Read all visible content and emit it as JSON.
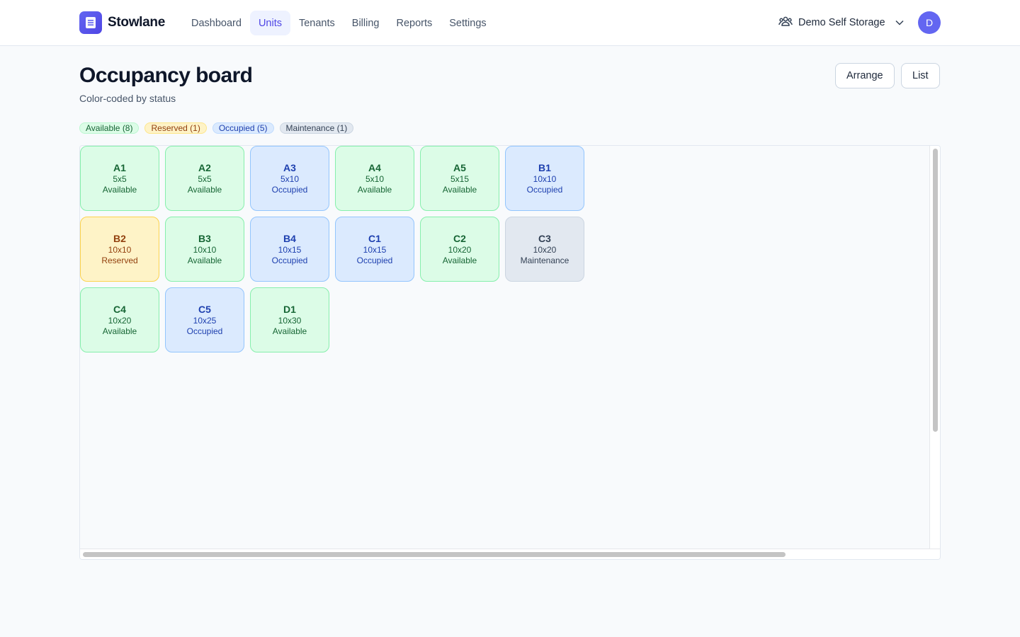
{
  "app": {
    "name": "Stowlane",
    "logo_icon": "document-list-icon"
  },
  "nav": {
    "items": [
      {
        "label": "Dashboard",
        "active": false
      },
      {
        "label": "Units",
        "active": true
      },
      {
        "label": "Tenants",
        "active": false
      },
      {
        "label": "Billing",
        "active": false
      },
      {
        "label": "Reports",
        "active": false
      },
      {
        "label": "Settings",
        "active": false
      }
    ]
  },
  "org": {
    "name": "Demo Self Storage",
    "icon": "users-icon",
    "chevron": "chevron-down-icon"
  },
  "user": {
    "initial": "D",
    "avatar_color": "#6366f1"
  },
  "page": {
    "title": "Occupancy board",
    "subtitle": "Color-coded by status",
    "actions": {
      "arrange": "Arrange",
      "list": "List"
    }
  },
  "legend": [
    {
      "key": "available",
      "label": "Available (8)"
    },
    {
      "key": "reserved",
      "label": "Reserved (1)"
    },
    {
      "key": "occupied",
      "label": "Occupied (5)"
    },
    {
      "key": "maintenance",
      "label": "Maintenance (1)"
    }
  ],
  "status_colors": {
    "available": "#dcfce7",
    "reserved": "#fef3c7",
    "occupied": "#dbeafe",
    "maintenance": "#e2e8f0"
  },
  "units": [
    {
      "name": "A1",
      "size": "5x5",
      "status": "Available",
      "key": "available"
    },
    {
      "name": "A2",
      "size": "5x5",
      "status": "Available",
      "key": "available"
    },
    {
      "name": "A3",
      "size": "5x10",
      "status": "Occupied",
      "key": "occupied"
    },
    {
      "name": "A4",
      "size": "5x10",
      "status": "Available",
      "key": "available"
    },
    {
      "name": "A5",
      "size": "5x15",
      "status": "Available",
      "key": "available"
    },
    {
      "name": "B1",
      "size": "10x10",
      "status": "Occupied",
      "key": "occupied"
    },
    {
      "name": "B2",
      "size": "10x10",
      "status": "Reserved",
      "key": "reserved"
    },
    {
      "name": "B3",
      "size": "10x10",
      "status": "Available",
      "key": "available"
    },
    {
      "name": "B4",
      "size": "10x15",
      "status": "Occupied",
      "key": "occupied"
    },
    {
      "name": "C1",
      "size": "10x15",
      "status": "Occupied",
      "key": "occupied"
    },
    {
      "name": "C2",
      "size": "10x20",
      "status": "Available",
      "key": "available"
    },
    {
      "name": "C3",
      "size": "10x20",
      "status": "Maintenance",
      "key": "maintenance"
    },
    {
      "name": "C4",
      "size": "10x20",
      "status": "Available",
      "key": "available"
    },
    {
      "name": "C5",
      "size": "10x25",
      "status": "Occupied",
      "key": "occupied"
    },
    {
      "name": "D1",
      "size": "10x30",
      "status": "Available",
      "key": "available"
    }
  ]
}
